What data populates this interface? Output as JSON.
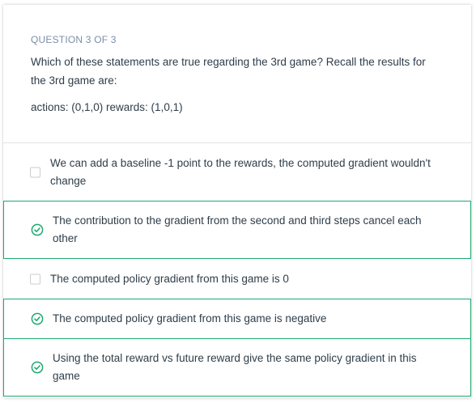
{
  "question": {
    "label": "QUESTION 3 OF 3",
    "text": "Which of these statements are true regarding the 3rd game? Recall the results for the 3rd game are:",
    "results": "actions: (0,1,0) rewards: (1,0,1)"
  },
  "options": [
    {
      "text": "We can add a baseline -1 point to the rewards, the computed gradient wouldn't change",
      "selected": false
    },
    {
      "text": "The contribution to the gradient from the second and third steps cancel each other",
      "selected": true
    },
    {
      "text": "The computed policy gradient from this game is 0",
      "selected": false
    },
    {
      "text": "The computed policy gradient from this game is negative",
      "selected": true
    },
    {
      "text": "Using the total reward vs future reward give the same policy gradient in this game",
      "selected": true
    }
  ],
  "colors": {
    "correct": "#1fa971",
    "label": "#7a8ea8",
    "text": "#2e3d49"
  },
  "icons": {
    "selected": "check-circle-icon",
    "unselected": "checkbox-empty"
  }
}
